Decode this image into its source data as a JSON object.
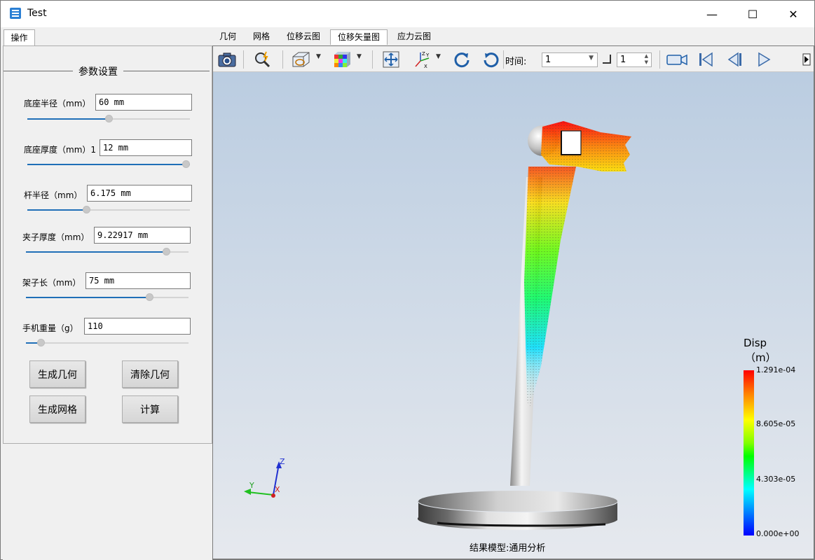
{
  "window": {
    "title": "Test",
    "minimize": "—",
    "maximize": "☐",
    "close": "✕"
  },
  "left_tab": "操作",
  "params": {
    "group_title": "参数设置",
    "fields": [
      {
        "label": "底座半径（mm）",
        "value": "60 mm",
        "slider": 0.5
      },
      {
        "label": "底座厚度（mm）1",
        "value": "12 mm",
        "slider": 1.0
      },
      {
        "label": "杆半径（mm）",
        "value": "6.175 mm",
        "slider": 0.36
      },
      {
        "label": "夹子厚度（mm）",
        "value": "9.22917 mm",
        "slider": 0.86
      },
      {
        "label": "架子长（mm）",
        "value": "75 mm",
        "slider": 0.76
      },
      {
        "label": "手机重量（g）",
        "value": "110",
        "slider": 0.09
      }
    ]
  },
  "buttons": {
    "gen_geometry": "生成几何",
    "clear_geometry": "清除几何",
    "gen_mesh": "生成网格",
    "compute": "计算"
  },
  "view_tabs": [
    "几何",
    "网格",
    "位移云图",
    "位移矢量图",
    "应力云图"
  ],
  "active_view_tab": "位移矢量图",
  "toolbar": {
    "time_label": "时间:",
    "time_value": "1",
    "step_value": "1",
    "icons": [
      "camera-icon",
      "zoom-icon",
      "view-box-icon",
      "color-cube-icon",
      "fit-view-icon",
      "axes-icon",
      "rotate-cw-icon",
      "rotate-ccw-icon",
      "record-icon",
      "first-frame-icon",
      "previous-frame-icon",
      "play-icon",
      "more-icon"
    ]
  },
  "legend": {
    "title": "Disp",
    "unit": "（m）",
    "max": "1.291e-04",
    "v2": "8.605e-05",
    "v1": "4.303e-05",
    "min": "0.000e+00",
    "colors": [
      "#ff0000",
      "#ffff00",
      "#00ff00",
      "#00ffff",
      "#0000ff"
    ]
  },
  "scene": {
    "model_label": "结果模型:通用分析",
    "axis_labels": {
      "z": "Z",
      "y": "Y",
      "x": "X"
    }
  }
}
